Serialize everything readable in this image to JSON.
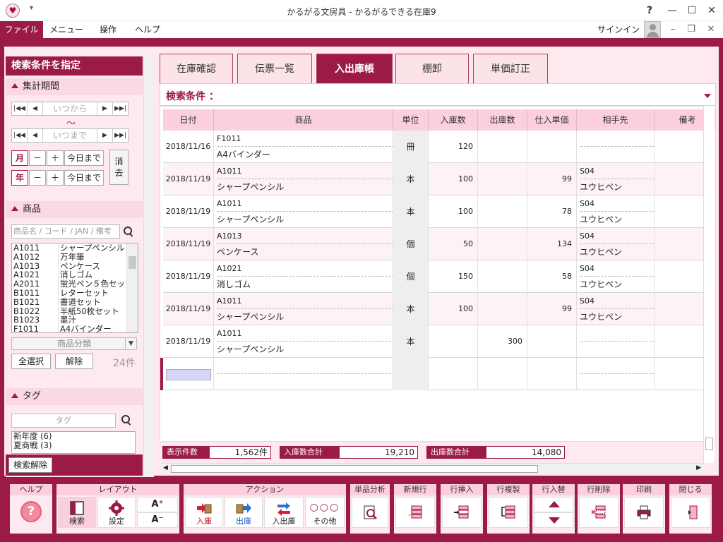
{
  "window": {
    "title": "かるがる文房具 - かるがるできる在庫9",
    "help": "?",
    "minimize": "—",
    "maximize": "☐",
    "close": "✕"
  },
  "menu": {
    "file": "ファイル",
    "items": [
      "メニュー",
      "操作",
      "ヘルプ"
    ],
    "signin": "サインイン"
  },
  "left": {
    "header": "検索条件を指定",
    "period": {
      "title": "集計期間",
      "from_placeholder": "いつから",
      "to_placeholder": "いつまで",
      "tilde": "～",
      "month": "月",
      "year": "年",
      "minus": "－",
      "plus": "＋",
      "today": "今日まで",
      "clear": "消去"
    },
    "products": {
      "title": "商品",
      "search_placeholder": "商品名 / コード / JAN / 備考",
      "list": [
        {
          "code": "A1011",
          "name": "シャープペンシル"
        },
        {
          "code": "A1012",
          "name": "万年筆"
        },
        {
          "code": "A1013",
          "name": "ペンケース"
        },
        {
          "code": "A1021",
          "name": "消しゴム"
        },
        {
          "code": "A2011",
          "name": "蛍光ペン５色セッ"
        },
        {
          "code": "B1011",
          "name": "レターセット"
        },
        {
          "code": "B1021",
          "name": "書道セット"
        },
        {
          "code": "B1022",
          "name": "半紙50枚セット"
        },
        {
          "code": "B1023",
          "name": "墨汁"
        },
        {
          "code": "F1011",
          "name": "A4バインダー"
        }
      ],
      "category": "商品分類",
      "select_all": "全選択",
      "deselect": "解除",
      "count": "24件"
    },
    "tags": {
      "title": "タグ",
      "search_placeholder": "タグ",
      "list": [
        "新年度 (6)",
        "夏商戦 (3)"
      ]
    },
    "search_clear": "検索解除"
  },
  "tabs": [
    "在庫確認",
    "伝票一覧",
    "入出庫帳",
    "棚卸",
    "単価訂正"
  ],
  "conditions_label": "検索条件 ：",
  "table": {
    "headers": [
      "日付",
      "商品",
      "単位",
      "入庫数",
      "出庫数",
      "仕入単価",
      "相手先",
      "備考"
    ],
    "rows": [
      {
        "date": "2018/11/16",
        "code": "F1011",
        "name": "A4バインダー",
        "unit": "冊",
        "in": "120",
        "out": "",
        "price": "",
        "partner_code": "",
        "partner_name": ""
      },
      {
        "date": "2018/11/19",
        "code": "A1011",
        "name": "シャープペンシル",
        "unit": "本",
        "in": "100",
        "out": "",
        "price": "99",
        "partner_code": "S04",
        "partner_name": "ユウヒペン"
      },
      {
        "date": "2018/11/19",
        "code": "A1011",
        "name": "シャープペンシル",
        "unit": "本",
        "in": "100",
        "out": "",
        "price": "78",
        "partner_code": "S04",
        "partner_name": "ユウヒペン"
      },
      {
        "date": "2018/11/19",
        "code": "A1013",
        "name": "ペンケース",
        "unit": "個",
        "in": "50",
        "out": "",
        "price": "134",
        "partner_code": "S04",
        "partner_name": "ユウヒペン"
      },
      {
        "date": "2018/11/19",
        "code": "A1021",
        "name": "消しゴム",
        "unit": "個",
        "in": "150",
        "out": "",
        "price": "58",
        "partner_code": "S04",
        "partner_name": "ユウヒペン"
      },
      {
        "date": "2018/11/19",
        "code": "A1011",
        "name": "シャープペンシル",
        "unit": "本",
        "in": "100",
        "out": "",
        "price": "99",
        "partner_code": "S04",
        "partner_name": "ユウヒペン"
      },
      {
        "date": "2018/11/19",
        "code": "A1011",
        "name": "シャープペンシル",
        "unit": "本",
        "in": "",
        "out": "300",
        "price": "",
        "partner_code": "",
        "partner_name": ""
      }
    ]
  },
  "summary": {
    "count_label": "表示件数",
    "count": "1,562件",
    "in_label": "入庫数合計",
    "in_total": "19,210",
    "out_label": "出庫数合計",
    "out_total": "14,080"
  },
  "toolbar": {
    "help_group": "ヘルプ",
    "layout_group": "レイアウト",
    "search": "検索",
    "settings": "設定",
    "font_up": "A⁺",
    "font_down": "A⁻",
    "action_group": "アクション",
    "in": "入庫",
    "out": "出庫",
    "inout": "入出庫",
    "other": "その他",
    "analysis": "単品分析",
    "new_row": "新規行",
    "insert_row": "行挿入",
    "copy_row": "行複製",
    "swap_row": "行入替",
    "delete_row": "行削除",
    "print": "印刷",
    "close": "閉じる"
  },
  "colors": {
    "accent": "#9b1a46",
    "light": "#fde9ee",
    "header": "#fbd0dc"
  }
}
